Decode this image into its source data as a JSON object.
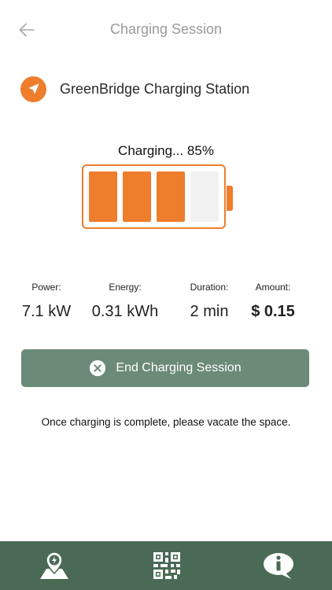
{
  "header": {
    "title": "Charging Session"
  },
  "station": {
    "name": "GreenBridge Charging Station"
  },
  "charging": {
    "status": "Charging... 85%",
    "level_percent": 85,
    "filled_cells": 3,
    "total_cells": 4
  },
  "stats": [
    {
      "label": "Power:",
      "value": "7.1 kW"
    },
    {
      "label": "Energy:",
      "value": "0.31 kWh"
    },
    {
      "label": "Duration:",
      "value": "2 min"
    },
    {
      "label": "Amount:",
      "value": "$ 0.15"
    }
  ],
  "actions": {
    "end_session_label": "End Charging Session"
  },
  "note": "Once charging is complete, please vacate the space.",
  "nav": {
    "items": [
      {
        "icon": "map-charging-icon"
      },
      {
        "icon": "qr-code-icon"
      },
      {
        "icon": "info-chat-icon"
      }
    ]
  },
  "colors": {
    "accent": "#ee7d2c",
    "button": "#6b8a78",
    "nav": "#4a6a55"
  }
}
